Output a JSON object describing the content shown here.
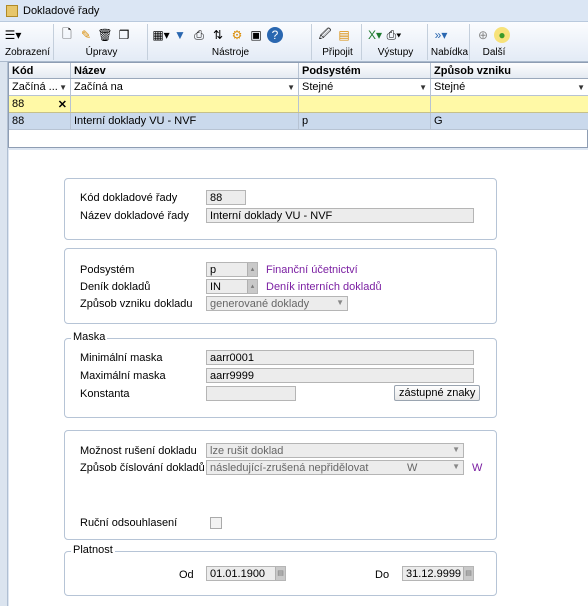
{
  "window": {
    "title": "Dokladové řady"
  },
  "toolbar": {
    "groups": [
      {
        "label": "Zobrazení"
      },
      {
        "label": "Úpravy"
      },
      {
        "label": "Nástroje"
      },
      {
        "label": "Připojit"
      },
      {
        "label": "Výstupy"
      },
      {
        "label": "Nabídka"
      },
      {
        "label": "Další"
      }
    ]
  },
  "grid": {
    "columns": [
      "Kód",
      "Název",
      "Podsystém",
      "Způsob vzniku"
    ],
    "filters": [
      "Začíná ...",
      "Začíná na",
      "Stejné",
      "Stejné"
    ],
    "input_value": "88",
    "clear_symbol": "✕",
    "rows": [
      {
        "kod": "88",
        "nazev": "Interní doklady VU - NVF",
        "podsystem": "p",
        "zpusob": "G"
      }
    ]
  },
  "form": {
    "kod_label": "Kód dokladové řady",
    "kod_value": "88",
    "nazev_label": "Název dokladové řady",
    "nazev_value": "Interní doklady VU - NVF",
    "podsystem_label": "Podsystém",
    "podsystem_value": "p",
    "podsystem_link": "Finanční účetnictví",
    "denik_label": "Deník dokladů",
    "denik_value": "IN",
    "denik_link": "Deník interních dokladů",
    "zpusob_label": "Způsob vzniku dokladu",
    "zpusob_value": "generované doklady",
    "maska_legend": "Maska",
    "min_label": "Minimální maska",
    "min_value": "aarr0001",
    "max_label": "Maximální maska",
    "max_value": "aarr9999",
    "konst_label": "Konstanta",
    "konst_value": "",
    "zastupne_button": "zástupné znaky",
    "ruseni_label": "Možnost rušení dokladu",
    "ruseni_value": "lze rušit doklad",
    "cislovani_label": "Způsob číslování dokladů",
    "cislovani_value": "následující-zrušená nepřidělovat",
    "cislovani_code": "W",
    "cislovani_code_side": "W",
    "odsouhlaseni_label": "Ruční odsouhlasení",
    "platnost_legend": "Platnost",
    "od_label": "Od",
    "od_value": "01.01.1900",
    "do_label": "Do",
    "do_value": "31.12.9999"
  },
  "colors": {
    "link": "#7b1fa2",
    "filter_row": "#fff9a6",
    "selected_row": "#cad9ec"
  }
}
